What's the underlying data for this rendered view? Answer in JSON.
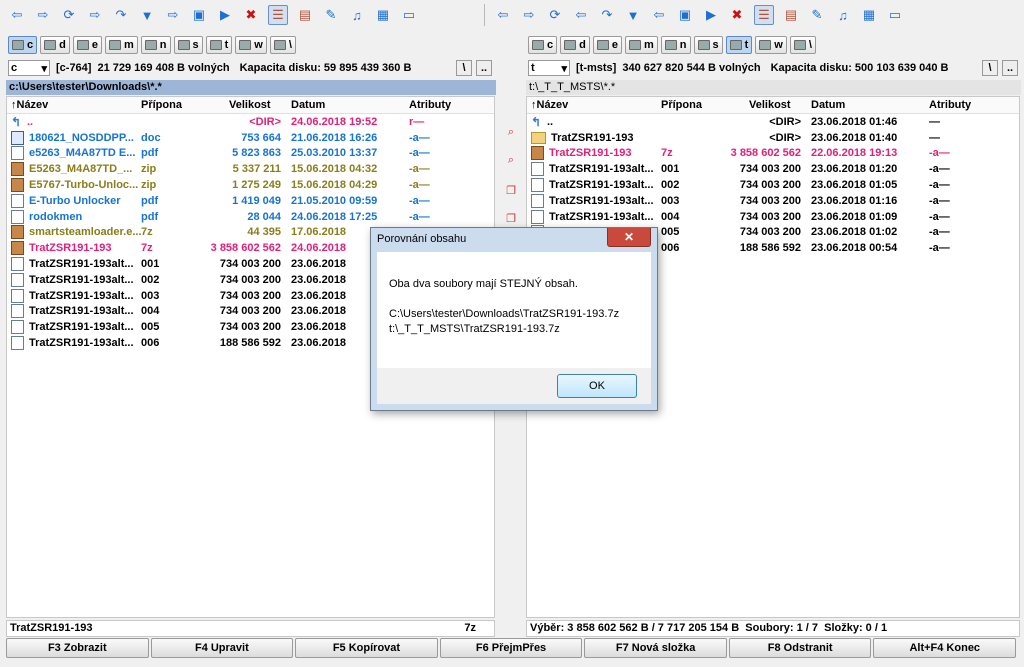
{
  "toolbar": {
    "left": [
      "arrow-left-icon",
      "arrow-right-icon",
      "sync-icon",
      "arrow-right-icon",
      "arrows-icon",
      "filter-icon",
      "arrow-right-icon",
      "window-icon",
      "play-icon",
      "delete-icon",
      "list-view-icon",
      "panel-view-icon",
      "edit-icon",
      "music-icon",
      "film-icon",
      "image-icon"
    ],
    "right": [
      "arrow-left-icon",
      "arrow-right-icon",
      "sync-icon",
      "arrow-left-icon",
      "arrows-icon",
      "filter-icon",
      "arrow-left-icon",
      "window-icon",
      "play-icon",
      "delete-icon",
      "list-view-icon",
      "panel-view-icon",
      "edit-icon",
      "music-icon",
      "film-icon",
      "image-icon"
    ],
    "glyphs": {
      "arrow-left-icon": "⇦",
      "arrow-right-icon": "⇨",
      "sync-icon": "⟳",
      "arrows-icon": "↷",
      "filter-icon": "▼",
      "window-icon": "▣",
      "play-icon": "▶",
      "delete-icon": "✖",
      "list-view-icon": "☰",
      "panel-view-icon": "▤",
      "edit-icon": "✎",
      "music-icon": "♫",
      "film-icon": "▦",
      "image-icon": "▭"
    }
  },
  "left": {
    "drives": [
      "c",
      "d",
      "e",
      "m",
      "n",
      "s",
      "t",
      "w",
      "\\"
    ],
    "active_drive": "c",
    "drive_combo": "c",
    "drive_label": "[c-764]",
    "free": "21 729 169 408 B volných",
    "capacity": "Kapacita disku: 59 895 439 360 B",
    "root_btn": "\\",
    "up_btn": "..",
    "path": "c:\\Users\\tester\\Downloads\\*.*",
    "columns": {
      "name": "Název",
      "ext": "Přípona",
      "size": "Velikost",
      "date": "Datum",
      "attr": "Atributy"
    },
    "rows": [
      {
        "icon": "up",
        "name": "..",
        "ext": "",
        "size": "<DIR>",
        "date": "24.06.2018 19:52",
        "attr": "r—",
        "color": "pink"
      },
      {
        "icon": "doc",
        "name": "180621_NOSDDPP...",
        "ext": "doc",
        "size": "753 664",
        "date": "21.06.2018 16:26",
        "attr": "-a—",
        "color": "blue"
      },
      {
        "icon": "file",
        "name": "e5263_M4A87TD E...",
        "ext": "pdf",
        "size": "5 823 863",
        "date": "25.03.2010 13:37",
        "attr": "-a—",
        "color": "blue"
      },
      {
        "icon": "zip",
        "name": "E5263_M4A87TD_...",
        "ext": "zip",
        "size": "5 337 211",
        "date": "15.06.2018 04:32",
        "attr": "-a—",
        "color": "olive"
      },
      {
        "icon": "zip",
        "name": "E5767-Turbo-Unloc...",
        "ext": "zip",
        "size": "1 275 249",
        "date": "15.06.2018 04:29",
        "attr": "-a—",
        "color": "olive"
      },
      {
        "icon": "file",
        "name": "E-Turbo Unlocker",
        "ext": "pdf",
        "size": "1 419 049",
        "date": "21.05.2010 09:59",
        "attr": "-a—",
        "color": "blue"
      },
      {
        "icon": "file",
        "name": "rodokmen",
        "ext": "pdf",
        "size": "28 044",
        "date": "24.06.2018 17:25",
        "attr": "-a—",
        "color": "blue"
      },
      {
        "icon": "zip",
        "name": "smartsteamloader.e...",
        "ext": "7z",
        "size": "44 395",
        "date": "17.06.2018",
        "attr": "",
        "color": "olive"
      },
      {
        "icon": "zip",
        "name": "TratZSR191-193",
        "ext": "7z",
        "size": "3 858 602 562",
        "date": "24.06.2018",
        "attr": "",
        "color": "pink"
      },
      {
        "icon": "file",
        "name": "TratZSR191-193alt...",
        "ext": "001",
        "size": "734 003 200",
        "date": "23.06.2018",
        "attr": "",
        "color": "black"
      },
      {
        "icon": "file",
        "name": "TratZSR191-193alt...",
        "ext": "002",
        "size": "734 003 200",
        "date": "23.06.2018",
        "attr": "",
        "color": "black"
      },
      {
        "icon": "file",
        "name": "TratZSR191-193alt...",
        "ext": "003",
        "size": "734 003 200",
        "date": "23.06.2018",
        "attr": "",
        "color": "black"
      },
      {
        "icon": "file",
        "name": "TratZSR191-193alt...",
        "ext": "004",
        "size": "734 003 200",
        "date": "23.06.2018",
        "attr": "",
        "color": "black"
      },
      {
        "icon": "file",
        "name": "TratZSR191-193alt...",
        "ext": "005",
        "size": "734 003 200",
        "date": "23.06.2018",
        "attr": "",
        "color": "black"
      },
      {
        "icon": "file",
        "name": "TratZSR191-193alt...",
        "ext": "006",
        "size": "188 586 592",
        "date": "23.06.2018",
        "attr": "",
        "color": "black"
      }
    ],
    "status_name": "TratZSR191-193",
    "status_ext": "7z"
  },
  "right": {
    "drives": [
      "c",
      "d",
      "e",
      "m",
      "n",
      "s",
      "t",
      "w",
      "\\"
    ],
    "active_drive": "t",
    "drive_combo": "t",
    "drive_label": "[t-msts]",
    "free": "340 627 820 544 B volných",
    "capacity": "Kapacita disku: 500 103 639 040 B",
    "root_btn": "\\",
    "up_btn": "..",
    "path": "t:\\_T_T_MSTS\\*.*",
    "columns": {
      "name": "Název",
      "ext": "Přípona",
      "size": "Velikost",
      "date": "Datum",
      "attr": "Atributy"
    },
    "rows": [
      {
        "icon": "up",
        "name": "..",
        "ext": "",
        "size": "<DIR>",
        "date": "23.06.2018 01:46",
        "attr": "—",
        "color": "black"
      },
      {
        "icon": "folder",
        "name": "TratZSR191-193",
        "ext": "",
        "size": "<DIR>",
        "date": "23.06.2018 01:40",
        "attr": "—",
        "color": "black"
      },
      {
        "icon": "zip",
        "name": "TratZSR191-193",
        "ext": "7z",
        "size": "3 858 602 562",
        "date": "22.06.2018 19:13",
        "attr": "-a—",
        "color": "pink"
      },
      {
        "icon": "file",
        "name": "TratZSR191-193alt...",
        "ext": "001",
        "size": "734 003 200",
        "date": "23.06.2018 01:20",
        "attr": "-a—",
        "color": "black"
      },
      {
        "icon": "file",
        "name": "TratZSR191-193alt...",
        "ext": "002",
        "size": "734 003 200",
        "date": "23.06.2018 01:05",
        "attr": "-a—",
        "color": "black"
      },
      {
        "icon": "file",
        "name": "TratZSR191-193alt...",
        "ext": "003",
        "size": "734 003 200",
        "date": "23.06.2018 01:16",
        "attr": "-a—",
        "color": "black"
      },
      {
        "icon": "file",
        "name": "TratZSR191-193alt...",
        "ext": "004",
        "size": "734 003 200",
        "date": "23.06.2018 01:09",
        "attr": "-a—",
        "color": "black"
      },
      {
        "icon": "file",
        "name": "",
        "ext": "005",
        "size": "734 003 200",
        "date": "23.06.2018 01:02",
        "attr": "-a—",
        "color": "black"
      },
      {
        "icon": "file",
        "name": "",
        "ext": "006",
        "size": "188 586 592",
        "date": "23.06.2018 00:54",
        "attr": "-a—",
        "color": "black"
      }
    ],
    "status": "Výběr: 3 858 602 562 B / 7 717 205 154 B  Soubory: 1 / 7  Složky: 0 / 1"
  },
  "dialog": {
    "title": "Porovnání obsahu",
    "close": "✕",
    "message": "Oba dva soubory mají STEJNÝ obsah.",
    "path1": "C:\\Users\\tester\\Downloads\\TratZSR191-193.7z",
    "path2": "t:\\_T_T_MSTS\\TratZSR191-193.7z",
    "ok": "OK"
  },
  "fkeys": [
    "F3 Zobrazit",
    "F4 Upravit",
    "F5 Kopírovat",
    "F6 PřejmPřes",
    "F7 Nová složka",
    "F8 Odstranit",
    "Alt+F4 Konec"
  ],
  "colors": {
    "blue": "#1773d2",
    "olive": "#8a7d1a",
    "pink": "#e0207a",
    "black": "#000000",
    "path_bg": "#9db6d8"
  }
}
